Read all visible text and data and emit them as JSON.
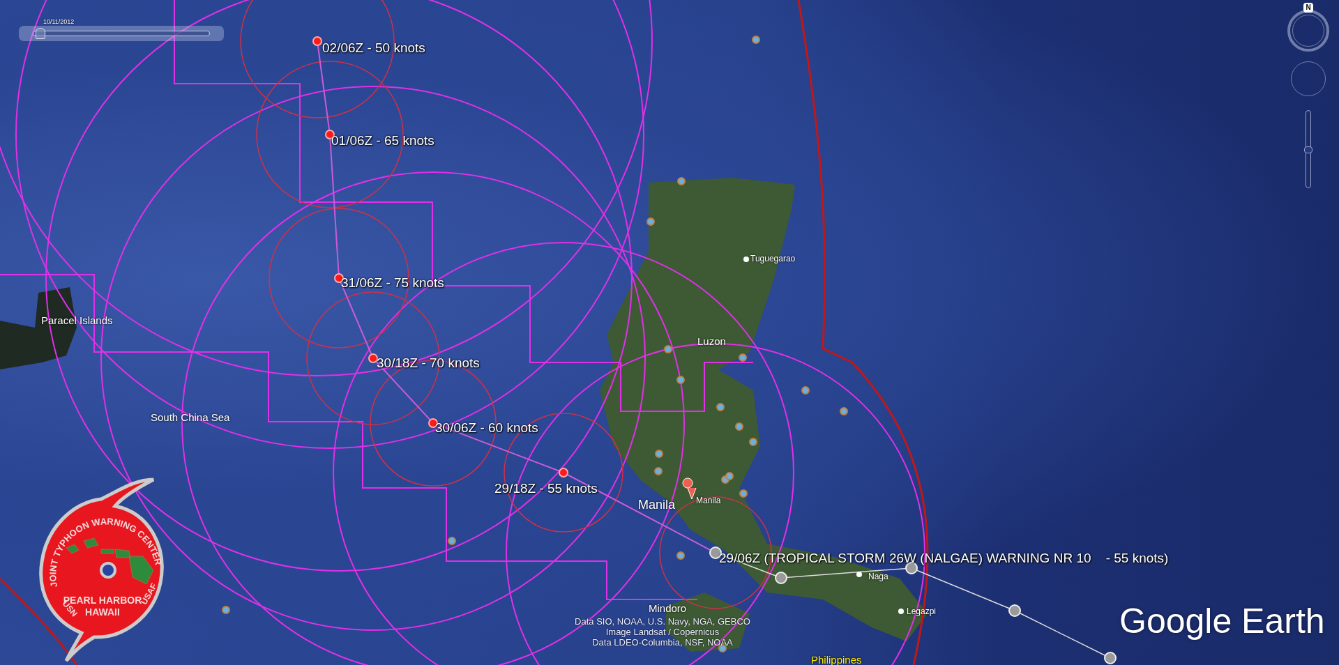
{
  "timeline": {
    "date": "10/11/2012",
    "level": 0.02
  },
  "compass": {
    "north": "N"
  },
  "zoom": {
    "level": 0.5
  },
  "forecast_points": [
    {
      "label": "02/06Z - 50 knots"
    },
    {
      "label": "01/06Z - 65 knots"
    },
    {
      "label": "31/06Z - 75 knots"
    },
    {
      "label": "30/18Z - 70 knots"
    },
    {
      "label": "30/06Z - 60 knots"
    },
    {
      "label": "29/18Z - 55 knots"
    },
    {
      "label": "29/06Z (TROPICAL STORM 26W (NALGAE) WARNING NR 10    - 55 knots)"
    }
  ],
  "place_labels": [
    {
      "text": "Paracel Islands",
      "kind": "region"
    },
    {
      "text": "South China Sea",
      "kind": "region"
    },
    {
      "text": "Tuguegarao",
      "kind": "city"
    },
    {
      "text": "Luzon",
      "kind": "region"
    },
    {
      "text": "Manila",
      "kind": "major"
    },
    {
      "text": "Manila",
      "kind": "pin"
    },
    {
      "text": "Naga",
      "kind": "city"
    },
    {
      "text": "Legazpi",
      "kind": "city"
    },
    {
      "text": "Mindoro",
      "kind": "region"
    },
    {
      "text": "Philippines",
      "kind": "country"
    }
  ],
  "logo": {
    "ring_text": "JOINT TYPHOON WARNING CENTER",
    "line_1": "PEARL HARBOR",
    "line_2": "HAWAII",
    "left_mark": "USN",
    "right_mark": "USAF"
  },
  "attribution": [
    "Data SIO, NOAA, U.S. Navy, NGA, GEBCO",
    "Image Landsat / Copernicus",
    "Data LDEO-Columbia, NSF, NOAA"
  ],
  "brand": "Google Earth"
}
